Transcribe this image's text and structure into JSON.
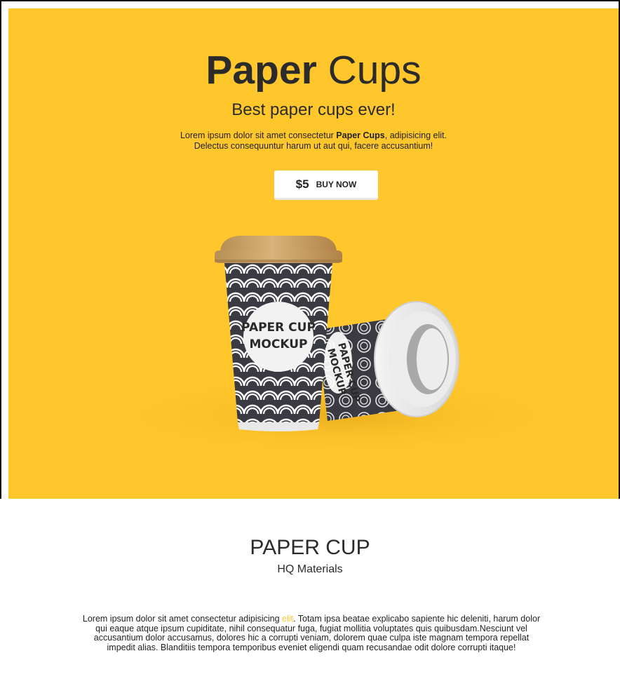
{
  "colors": {
    "hero_bg": "#ffc72c",
    "text": "#2b2b2b",
    "accent": "#ffc72c",
    "cup_dark": "#3a3a42",
    "lid_brown": "#c9a46d"
  },
  "hero": {
    "title_bold": "Paper",
    "title_light": "Cups",
    "subtitle": "Best paper cups ever!",
    "desc_pre": "Lorem ipsum dolor sit amet consectetur ",
    "desc_bold": "Paper Cups",
    "desc_mid": ", adipisicing elit.",
    "desc_line2": "Delectus consequuntur harum ut aut qui, facere accusantium!",
    "price": "$5",
    "buy_label": "BUY NOW",
    "cup_text_line1": "PAPER CUP",
    "cup_text_line2": "MOCKUP",
    "cup2_text_line1": "PAPER CUP",
    "cup2_text_line2": "MOCKUP"
  },
  "section": {
    "title": "PAPER CUP",
    "subtitle": "HQ Materials",
    "body_pre": "Lorem ipsum dolor sit amet consectetur adipisicing ",
    "body_link": "elit",
    "body_post": ". Totam ipsa beatae explicabo sapiente hic deleniti, harum dolor qui eaque atque ipsum cupiditate, nihil consequatur fuga, fugiat mollitia voluptates quis quibusdam.Nesciunt vel accusantium dolor accusamus, dolores hic a corrupti veniam, dolorem quae culpa iste magnam tempora repellat impedit alias. Blanditiis tempora temporibus eveniet eligendi quam recusandae odit dolore corrupti itaque!"
  }
}
